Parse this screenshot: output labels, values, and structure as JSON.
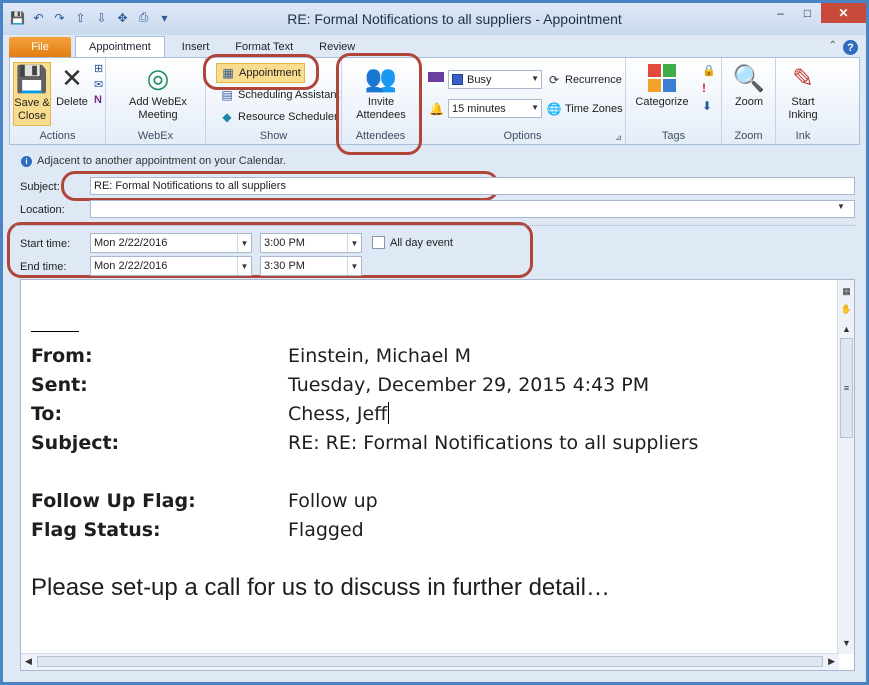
{
  "window": {
    "title": "RE: Formal Notifications to all suppliers  -  Appointment",
    "qat_icons": [
      "save-icon",
      "undo-icon",
      "redo-icon",
      "up-icon",
      "down-icon",
      "move-icon",
      "print-icon",
      "customize-icon"
    ],
    "controls": {
      "minimize": "–",
      "maximize": "□",
      "close": "✕"
    }
  },
  "tabs": [
    {
      "label": "File"
    },
    {
      "label": "Appointment"
    },
    {
      "label": "Insert"
    },
    {
      "label": "Format Text"
    },
    {
      "label": "Review"
    }
  ],
  "ribbon": {
    "actions": {
      "save_close": "Save &\nClose",
      "delete": "Delete",
      "label": "Actions"
    },
    "webex": {
      "add_meeting": "Add WebEx\nMeeting",
      "label": "WebEx"
    },
    "show": {
      "appointment": "Appointment",
      "scheduling": "Scheduling Assistant",
      "resource": "Resource Scheduler",
      "label": "Show"
    },
    "attendees": {
      "invite": "Invite\nAttendees",
      "label": "Attendees"
    },
    "options": {
      "show_as": "Busy",
      "reminder": "15 minutes",
      "recurrence": "Recurrence",
      "time_zones": "Time Zones",
      "label": "Options"
    },
    "tags": {
      "categorize": "Categorize",
      "label": "Tags"
    },
    "zoom": {
      "zoom": "Zoom",
      "label": "Zoom"
    },
    "ink": {
      "start_inking": "Start\nInking",
      "label": "Ink"
    }
  },
  "form": {
    "info": "Adjacent to another appointment on your Calendar.",
    "subject_label": "Subject:",
    "subject_value": "RE: Formal Notifications to all suppliers",
    "location_label": "Location:",
    "location_value": "",
    "start_label": "Start time:",
    "start_date": "Mon 2/22/2016",
    "start_time": "3:00 PM",
    "all_day": "All day event",
    "end_label": "End time:",
    "end_date": "Mon 2/22/2016",
    "end_time": "3:30 PM"
  },
  "body": {
    "from_k": "From:",
    "from_v": "Einstein, Michael M",
    "sent_k": "Sent:",
    "sent_v": "Tuesday, December 29, 2015 4:43 PM",
    "to_k": "To:",
    "to_v": "Chess, Jeff",
    "subject_k": "Subject:",
    "subject_v": "RE: RE: Formal Notifications to all suppliers",
    "flag_k": "Follow Up Flag:",
    "flag_v": "Follow up",
    "status_k": "Flag Status:",
    "status_v": "Flagged",
    "message": "Please set-up a call for us to discuss in further detail…"
  },
  "colors": {
    "accent": "#2f6cc0",
    "file_tab": "#e27d12",
    "annotation": "#b0463a",
    "close": "#c74a3a"
  }
}
